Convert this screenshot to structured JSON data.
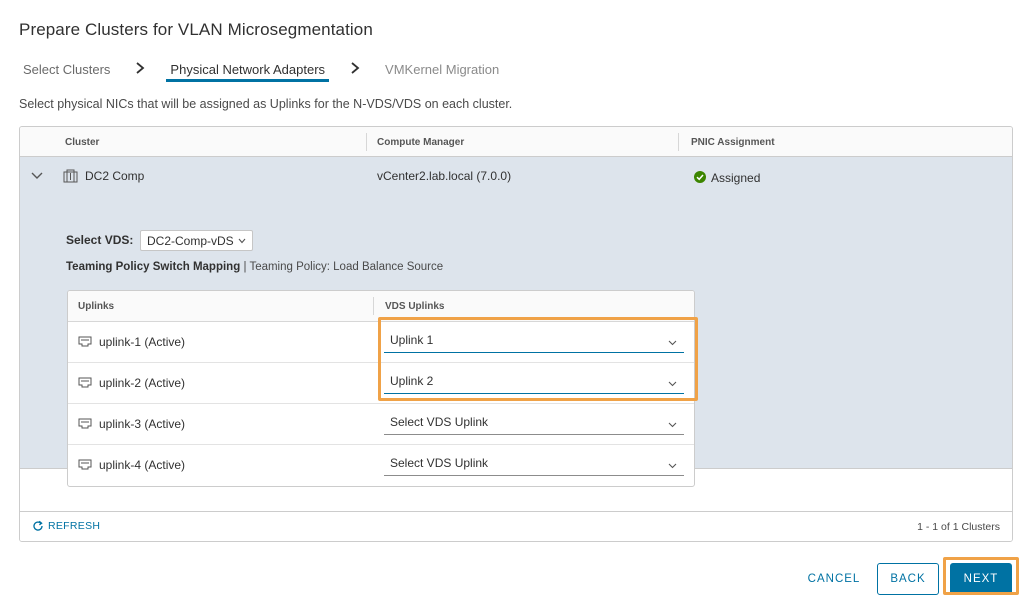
{
  "page": {
    "title": "Prepare Clusters for VLAN Microsegmentation",
    "description": "Select physical NICs that will be assigned as Uplinks for the N-VDS/VDS on each cluster."
  },
  "steps": [
    {
      "label": "Select Clusters",
      "state": "done"
    },
    {
      "label": "Physical Network Adapters",
      "state": "active"
    },
    {
      "label": "VMKernel Migration",
      "state": "disabled"
    }
  ],
  "grid": {
    "columns": [
      "Cluster",
      "Compute Manager",
      "PNIC Assignment"
    ],
    "rows": [
      {
        "cluster": "DC2 Comp",
        "compute_manager": "vCenter2.lab.local (7.0.0)",
        "pnic_assignment": "Assigned",
        "details": {
          "select_vds_label": "Select VDS:",
          "select_vds_value": "DC2-Comp-vDS",
          "teaming_title": "Teaming Policy Switch Mapping",
          "teaming_separator": "|",
          "teaming_policy": "Teaming Policy: Load Balance Source",
          "uplink_columns": [
            "Uplinks",
            "VDS Uplinks"
          ],
          "uplinks": [
            {
              "name": "uplink-1 (Active)",
              "vds_uplink": "Uplink 1"
            },
            {
              "name": "uplink-2 (Active)",
              "vds_uplink": "Uplink 2"
            },
            {
              "name": "uplink-3 (Active)",
              "vds_uplink": "Select VDS Uplink"
            },
            {
              "name": "uplink-4 (Active)",
              "vds_uplink": "Select VDS Uplink"
            }
          ]
        }
      }
    ],
    "footer": {
      "refresh_label": "REFRESH",
      "count": "1 - 1 of 1 Clusters"
    }
  },
  "buttons": {
    "cancel": "CANCEL",
    "back": "BACK",
    "next": "NEXT"
  },
  "colors": {
    "accent": "#0072a3",
    "highlight": "#f0a247",
    "expanded_row": "#dde4ec",
    "success": "#3c8500"
  },
  "icons": {
    "step_separator": "chevron-right-icon",
    "row_toggle": "chevron-down-icon",
    "cluster": "cluster-icon",
    "status": "check-circle-icon",
    "nic": "network-port-icon",
    "refresh": "refresh-icon"
  }
}
